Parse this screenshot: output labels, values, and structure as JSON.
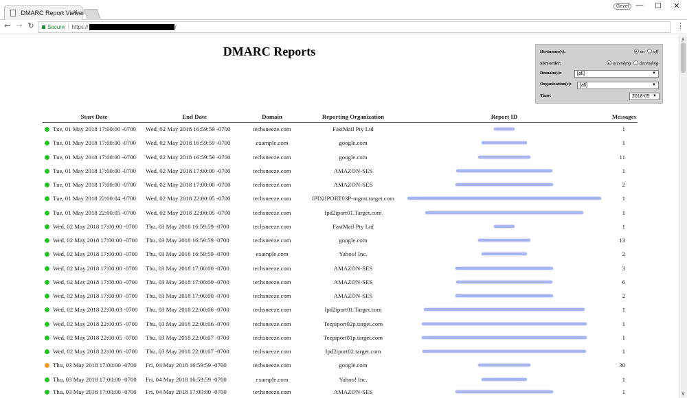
{
  "browser": {
    "tab_title": "DMARC Report Viewer",
    "tab_close": "×",
    "user_badge": "Gezel",
    "minimize": "—",
    "maximize": "☐",
    "close": "✕",
    "back": "←",
    "forward": "→",
    "reload": "↻",
    "secure_label": "Secure",
    "url_scheme": "https://",
    "url_tail": "/",
    "menu": "⋮"
  },
  "page": {
    "title": "DMARC Reports"
  },
  "filters": {
    "hostname_label": "Hostname(s):",
    "hostname_on": "on",
    "hostname_off": "off",
    "hostname_selected": "on",
    "sort_label": "Sort order:",
    "sort_ascending": "ascending",
    "sort_descending": "decending",
    "sort_selected": "ascending",
    "domain_label": "Domain(s):",
    "domain_value": "[all]",
    "org_label": "Organization(s):",
    "org_value": "[all]",
    "time_label": "Time:",
    "time_value": "2018-05"
  },
  "table": {
    "headers": {
      "start": "Start Date",
      "end": "End Date",
      "domain": "Domain",
      "org": "Reporting Organization",
      "id": "Report ID",
      "messages": "Messages"
    },
    "status_colors": {
      "pass": "#22c422",
      "partial": "#f59a23"
    },
    "rows": [
      {
        "status": "pass",
        "start": "Tue, 01 May 2018 17:00:00 -0700",
        "end": "Wed, 02 May 2018 16:59:59 -0700",
        "domain": "techsneeze.com",
        "org": "FastMail Pty Ltd",
        "id_width": 30,
        "messages": "1"
      },
      {
        "status": "pass",
        "start": "Tue, 01 May 2018 17:00:00 -0700",
        "end": "Wed, 02 May 2018 16:59:59 -0700",
        "domain": "example.com",
        "org": "google.com",
        "id_width": 66,
        "messages": "1"
      },
      {
        "status": "pass",
        "start": "Tue, 01 May 2018 17:00:00 -0700",
        "end": "Wed, 02 May 2018 16:59:59 -0700",
        "domain": "techsneeze.com",
        "org": "google.com",
        "id_width": 76,
        "messages": "11"
      },
      {
        "status": "pass",
        "start": "Tue, 01 May 2018 17:00:00 -0700",
        "end": "Wed, 02 May 2018 17:00:00 -0700",
        "domain": "techsneeze.com",
        "org": "AMAZON-SES",
        "id_width": 140,
        "messages": "1"
      },
      {
        "status": "pass",
        "start": "Tue, 01 May 2018 17:00:00 -0700",
        "end": "Wed, 02 May 2018 17:00:00 -0700",
        "domain": "techsneeze.com",
        "org": "AMAZON-SES",
        "id_width": 142,
        "messages": "2"
      },
      {
        "status": "pass",
        "start": "Tue, 01 May 2018 22:00:04 -0700",
        "end": "Wed, 02 May 2018 22:00:05 -0700",
        "domain": "techsneeze.com",
        "org": "IPD2IPORT03P-mgmt.target.com",
        "id_width": 282,
        "messages": "1"
      },
      {
        "status": "pass",
        "start": "Tue, 01 May 2018 22:00:05 -0700",
        "end": "Wed, 02 May 2018 22:00:05 -0700",
        "domain": "techsneeze.com",
        "org": "Ipd2iport01.Target.com",
        "id_width": 230,
        "messages": "1"
      },
      {
        "status": "pass",
        "start": "Wed, 02 May 2018 17:00:00 -0700",
        "end": "Thu, 03 May 2018 16:59:59 -0700",
        "domain": "techsneeze.com",
        "org": "FastMail Pty Ltd",
        "id_width": 30,
        "messages": "1"
      },
      {
        "status": "pass",
        "start": "Wed, 02 May 2018 17:00:00 -0700",
        "end": "Thu, 03 May 2018 16:59:59 -0700",
        "domain": "techsneeze.com",
        "org": "google.com",
        "id_width": 76,
        "messages": "13"
      },
      {
        "status": "pass",
        "start": "Wed, 02 May 2018 17:00:00 -0700",
        "end": "Thu, 03 May 2018 16:59:59 -0700",
        "domain": "example.com",
        "org": "Yahoo! Inc.",
        "id_width": 66,
        "messages": "2"
      },
      {
        "status": "pass",
        "start": "Wed, 02 May 2018 17:00:00 -0700",
        "end": "Thu, 03 May 2018 17:00:00 -0700",
        "domain": "techsneeze.com",
        "org": "AMAZON-SES",
        "id_width": 142,
        "messages": "3"
      },
      {
        "status": "pass",
        "start": "Wed, 02 May 2018 17:00:00 -0700",
        "end": "Thu, 03 May 2018 17:00:00 -0700",
        "domain": "techsneeze.com",
        "org": "AMAZON-SES",
        "id_width": 140,
        "messages": "6"
      },
      {
        "status": "pass",
        "start": "Wed, 02 May 2018 17:00:00 -0700",
        "end": "Thu, 03 May 2018 17:00:00 -0700",
        "domain": "techsneeze.com",
        "org": "AMAZON-SES",
        "id_width": 142,
        "messages": "2"
      },
      {
        "status": "pass",
        "start": "Wed, 02 May 2018 22:00:03 -0700",
        "end": "Thu, 03 May 2018 22:00:06 -0700",
        "domain": "techsneeze.com",
        "org": "Ipd2iport01.Target.com",
        "id_width": 234,
        "messages": "1"
      },
      {
        "status": "pass",
        "start": "Wed, 02 May 2018 22:00:05 -0700",
        "end": "Thu, 03 May 2018 22:00:06 -0700",
        "domain": "techsneeze.com",
        "org": "Tezpiport02p.target.com",
        "id_width": 240,
        "messages": "1"
      },
      {
        "status": "pass",
        "start": "Wed, 02 May 2018 22:00:05 -0700",
        "end": "Thu, 03 May 2018 22:00:07 -0700",
        "domain": "techsneeze.com",
        "org": "Tezpiport01p.target.com",
        "id_width": 240,
        "messages": "1"
      },
      {
        "status": "pass",
        "start": "Wed, 02 May 2018 22:00:06 -0700",
        "end": "Thu, 03 May 2018 22:00:07 -0700",
        "domain": "techsneeze.com",
        "org": "Ipd2iport02.target.com",
        "id_width": 238,
        "messages": "1"
      },
      {
        "status": "partial",
        "start": "Thu, 03 May 2018 17:00:00 -0700",
        "end": "Fri, 04 May 2018 16:59:59 -0700",
        "domain": "techsneeze.com",
        "org": "google.com",
        "id_width": 76,
        "messages": "30"
      },
      {
        "status": "pass",
        "start": "Thu, 03 May 2018 17:00:00 -0700",
        "end": "Fri, 04 May 2018 16:59:59 -0700",
        "domain": "example.com",
        "org": "Yahoo! Inc.",
        "id_width": 66,
        "messages": "1"
      },
      {
        "status": "pass",
        "start": "Thu, 03 May 2018 17:00:00 -0700",
        "end": "Fri, 04 May 2018 17:00:00 -0700",
        "domain": "techsneeze.com",
        "org": "AMAZON-SES",
        "id_width": 142,
        "messages": "1"
      }
    ]
  }
}
